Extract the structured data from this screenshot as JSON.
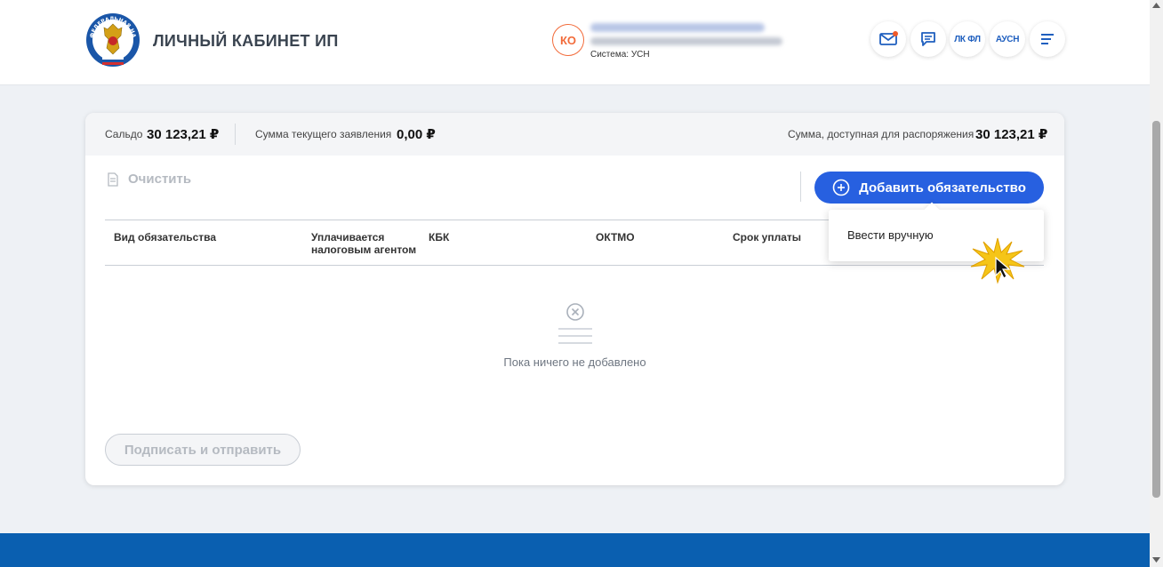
{
  "header": {
    "title": "ЛИЧНЫЙ КАБИНЕТ ИП",
    "logo_text": "ФЕДЕРАЛЬНАЯ НАЛОГОВАЯ СЛУЖБА",
    "avatar_initials": "КО",
    "system_label": "Система: УСН",
    "lk_fl_label": "ЛК ФЛ",
    "ausn_label": "АУСН"
  },
  "summary": {
    "saldo_label": "Сальдо",
    "saldo_value": "30 123,21 ₽",
    "current_label": "Сумма текущего заявления",
    "current_value": "0,00 ₽",
    "available_label": "Сумма, доступная для распоряжения",
    "available_value": "30 123,21 ₽"
  },
  "toolbar": {
    "clear_label": "Очистить",
    "add_label": "Добавить обязательство"
  },
  "table": {
    "columns": [
      "Вид обязательства",
      "Уплачивается налоговым агентом",
      "КБК",
      "ОКТМО",
      "Срок уплаты"
    ]
  },
  "empty_state": {
    "text": "Пока ничего не добавлено"
  },
  "dropdown": {
    "items": [
      "Ввести вручную"
    ]
  },
  "footer_actions": {
    "sign_label": "Подписать и отправить"
  },
  "colors": {
    "accent": "#2760e0",
    "footer": "#0a5fb0",
    "avatar": "#f26b3a"
  }
}
